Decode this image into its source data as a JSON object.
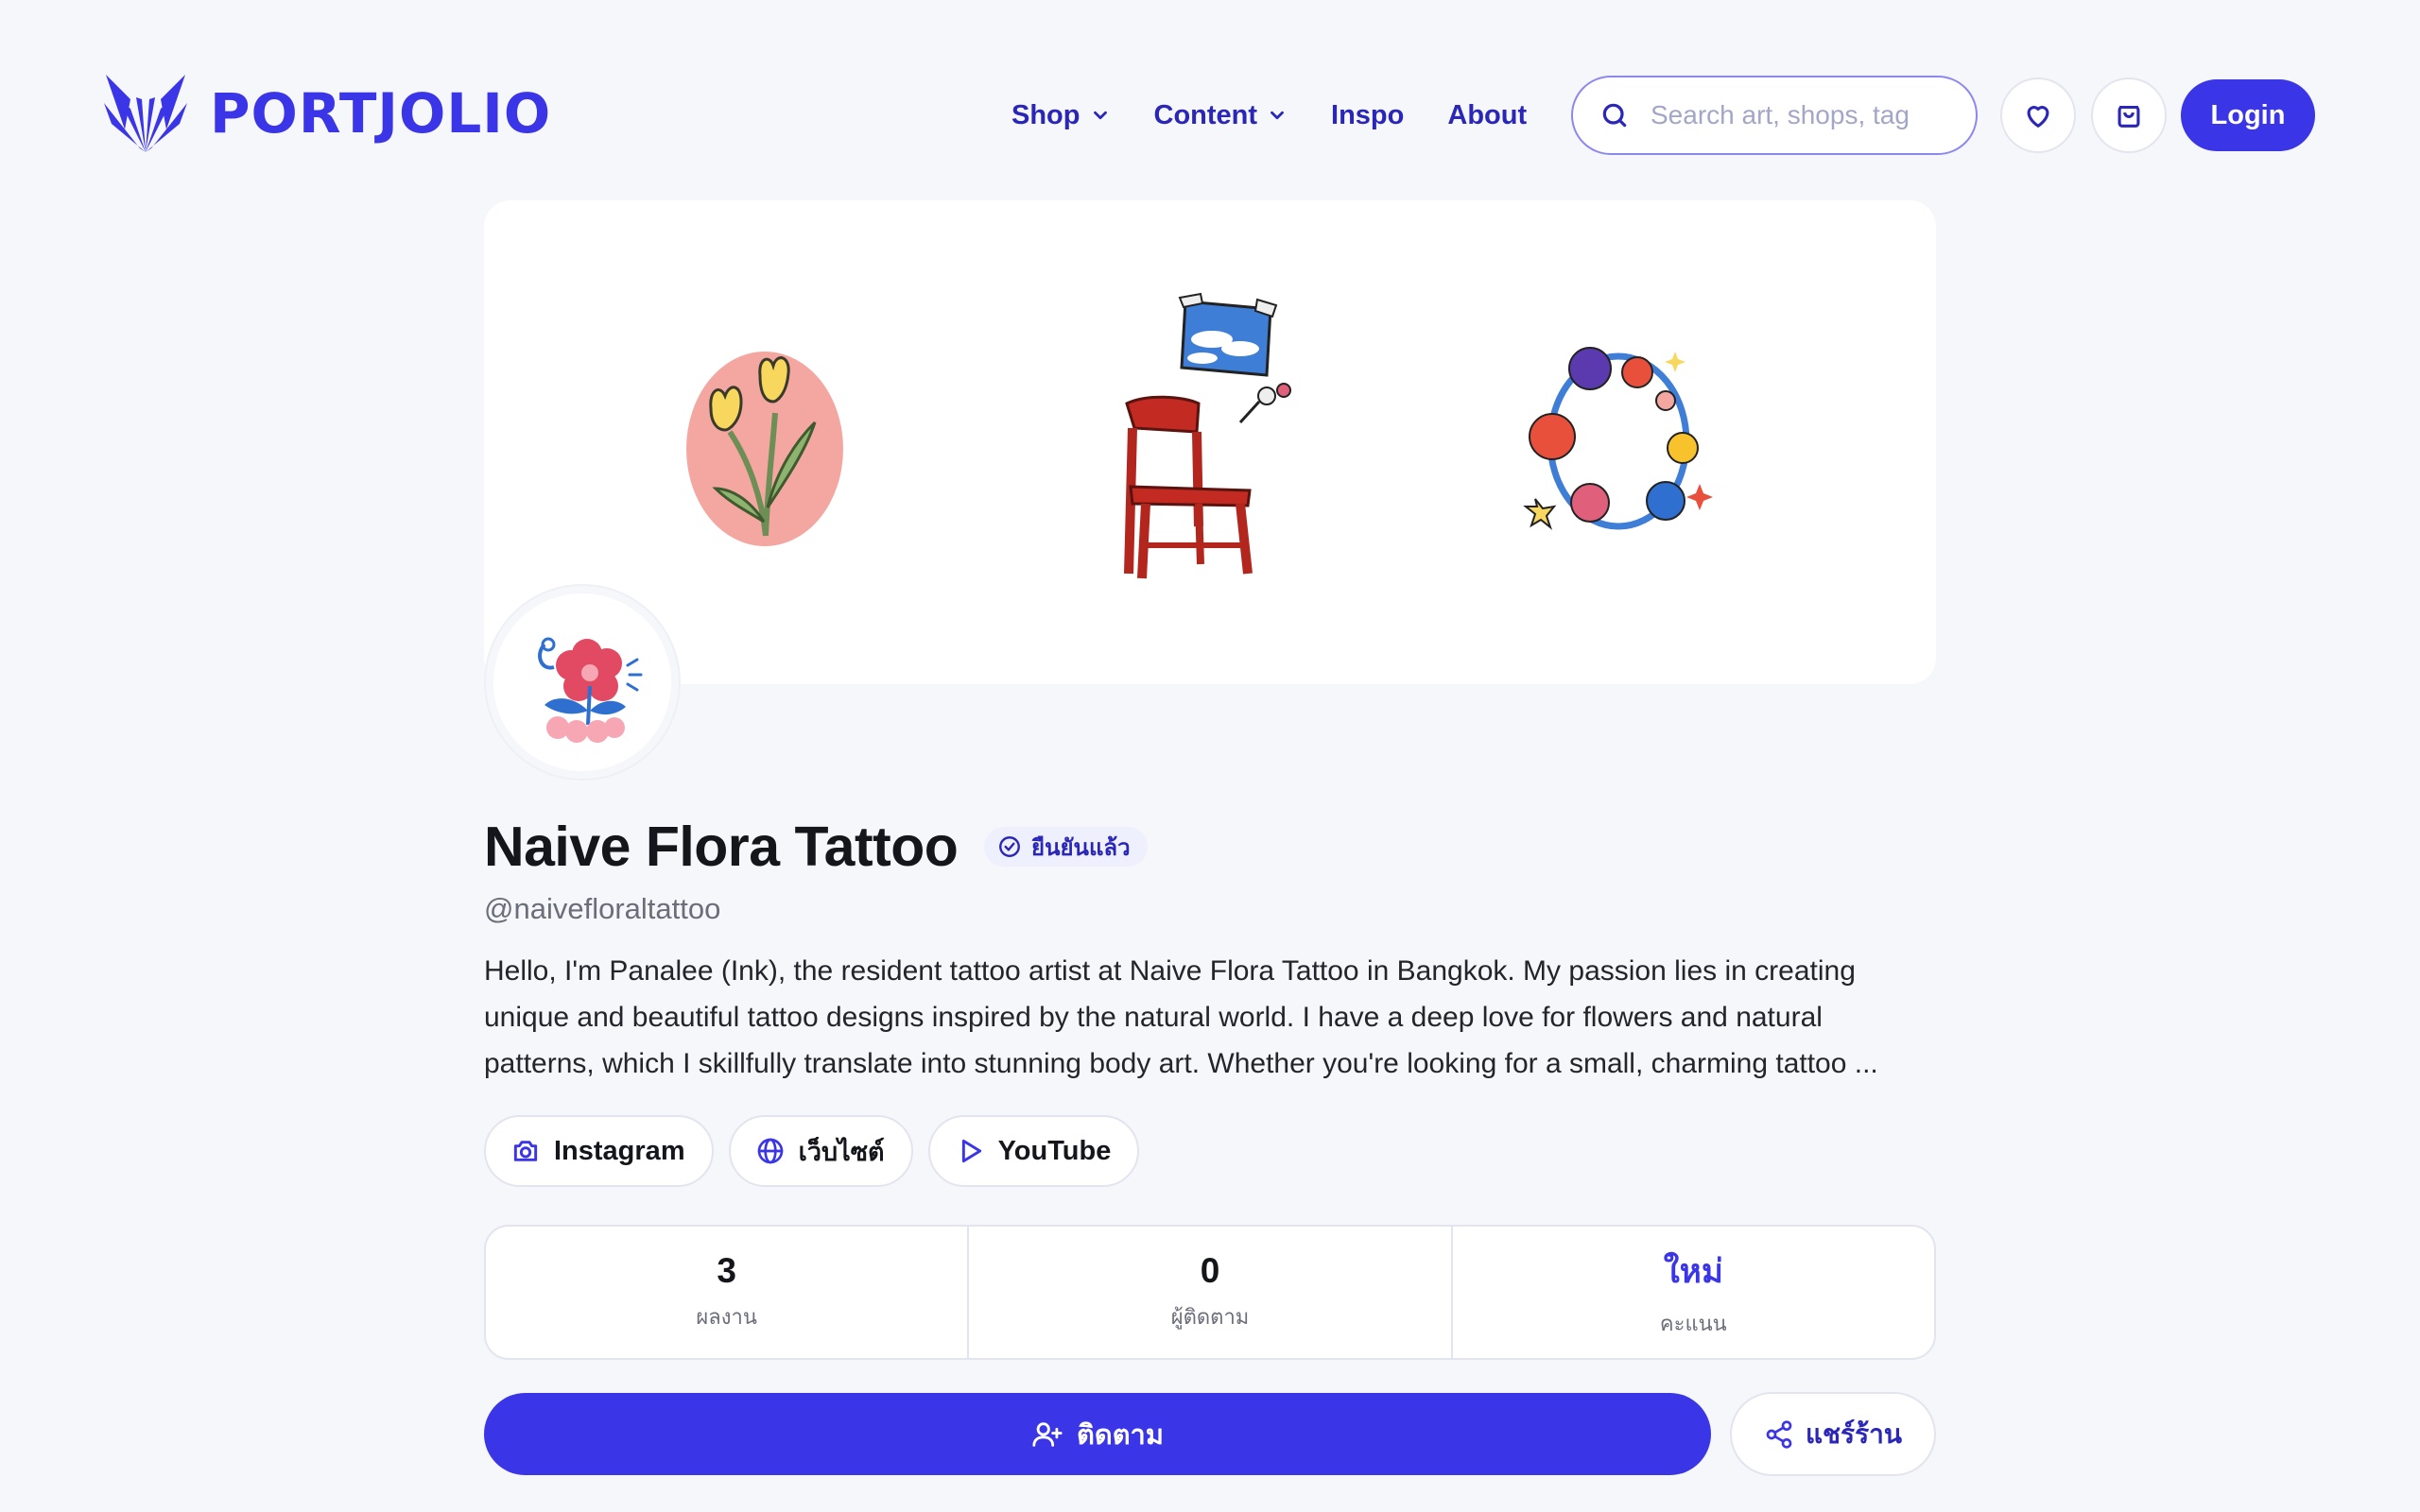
{
  "brand": {
    "name": "PORTJOLIO"
  },
  "nav": {
    "items": [
      {
        "label": "Shop",
        "has_dropdown": true
      },
      {
        "label": "Content",
        "has_dropdown": true
      },
      {
        "label": "Inspo",
        "has_dropdown": false
      },
      {
        "label": "About",
        "has_dropdown": false
      }
    ]
  },
  "search": {
    "placeholder": "Search art, shops, tag",
    "icon": "search-icon"
  },
  "header_actions": {
    "wishlist_icon": "heart-icon",
    "cart_icon": "shopping-bag-icon",
    "login_label": "Login"
  },
  "cover": {
    "illustrations": [
      "tulip-illustration",
      "chair-illustration",
      "flower-wreath-illustration"
    ]
  },
  "profile": {
    "name": "Naive Flora Tattoo",
    "verified_label": "ยืนยันแล้ว",
    "handle": "@naivefloraltattoo",
    "bio": "Hello, I'm Panalee (Ink), the resident tattoo artist at Naive Flora Tattoo in Bangkok. My passion lies in creating unique and beautiful tattoo designs inspired by the natural world. I have a deep love for flowers and natural patterns, which I skillfully translate into stunning body art. Whether you're looking for a small, charming tattoo ..."
  },
  "links": [
    {
      "label": "Instagram",
      "icon": "camera-icon"
    },
    {
      "label": "เว็บไซต์",
      "icon": "globe-icon"
    },
    {
      "label": "YouTube",
      "icon": "play-icon"
    }
  ],
  "stats": [
    {
      "value": "3",
      "label": "ผลงาน"
    },
    {
      "value": "0",
      "label": "ผู้ติดตาม"
    },
    {
      "value": "ใหม่",
      "label": "คะแนน"
    }
  ],
  "actions": {
    "follow_label": "ติดตาม",
    "share_label": "แชร์ร้าน"
  },
  "colors": {
    "accent": "#3b35e8",
    "nav_text": "#2a26b8",
    "background": "#f6f7fb"
  }
}
